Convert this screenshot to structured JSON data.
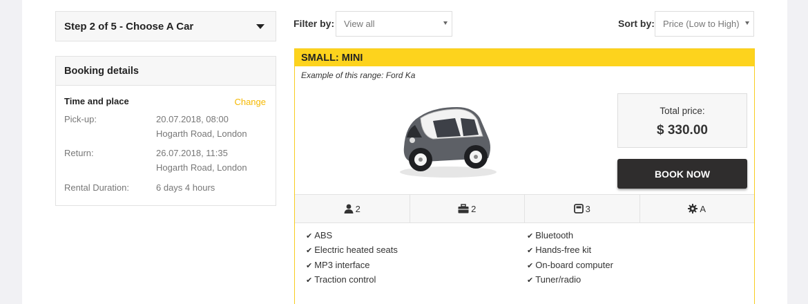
{
  "step": {
    "label": "Step 2 of 5 - Choose A Car"
  },
  "booking": {
    "title": "Booking details",
    "section_title": "Time and place",
    "change_label": "Change",
    "pickup": {
      "label": "Pick-up:",
      "datetime": "20.07.2018, 08:00",
      "place": "Hogarth Road, London"
    },
    "return": {
      "label": "Return:",
      "datetime": "26.07.2018, 11:35",
      "place": "Hogarth Road, London"
    },
    "duration": {
      "label": "Rental Duration:",
      "value": "6 days 4 hours"
    }
  },
  "filter": {
    "label": "Filter by:",
    "value": "View all"
  },
  "sort": {
    "label": "Sort by:",
    "value": "Price (Low to High)"
  },
  "car": {
    "category": "SMALL: MINI",
    "example": "Example of this range: Ford Ka",
    "total_label": "Total price:",
    "total_value": "$ 330.00",
    "book_label": "BOOK NOW",
    "specs": [
      {
        "icon": "user-icon",
        "value": "2"
      },
      {
        "icon": "suitcase-icon",
        "value": "2"
      },
      {
        "icon": "door-icon",
        "value": "3"
      },
      {
        "icon": "gear-icon",
        "value": "A"
      }
    ],
    "features_left": [
      "ABS",
      "Electric heated seats",
      "MP3 interface",
      "Traction control"
    ],
    "features_right": [
      "Bluetooth",
      "Hands-free kit",
      "On-board computer",
      "Tuner/radio"
    ]
  },
  "colors": {
    "accent": "#fdd31d",
    "link": "#f5b800",
    "button": "#2f2d2d"
  }
}
